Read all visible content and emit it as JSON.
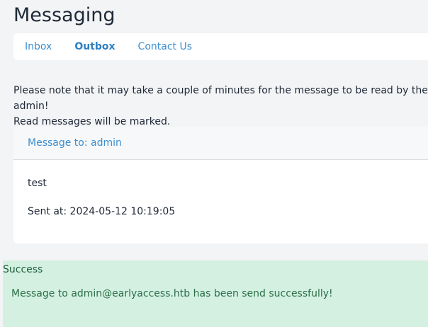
{
  "page": {
    "title": "Messaging"
  },
  "tabs": [
    {
      "label": "Inbox",
      "active": false
    },
    {
      "label": "Outbox",
      "active": true
    },
    {
      "label": "Contact Us",
      "active": false
    }
  ],
  "notice": {
    "line1": "Please note that it may take a couple of minutes for the message to be read by the admin!",
    "line2": "Read messages will be marked."
  },
  "message": {
    "header": "Message to: admin",
    "body": "test",
    "sent_at": "Sent at: 2024-05-12 10:19:05"
  },
  "alert": {
    "title": "Success",
    "text": "Message to admin@earlyaccess.htb has been send successfully!"
  },
  "colors": {
    "background": "#f3f4f6",
    "link": "#3b8ed0",
    "success_bg": "#d4f0e1",
    "success_text": "#2a6f48"
  }
}
